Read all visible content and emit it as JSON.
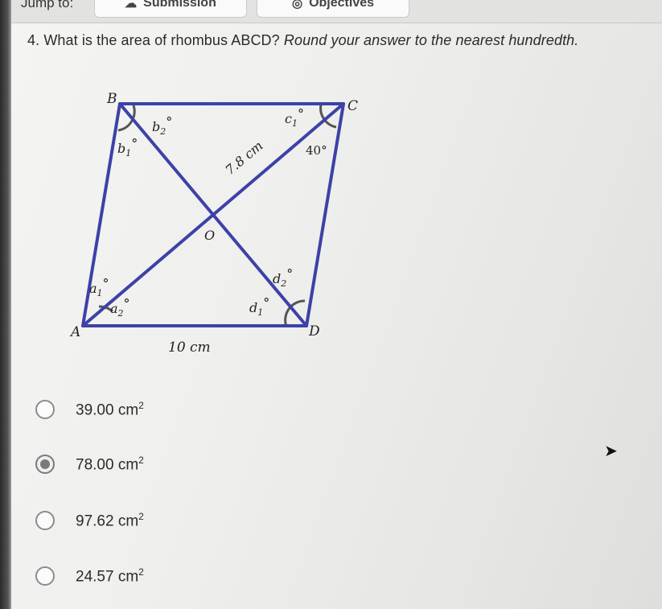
{
  "nav": {
    "jump_label": "Jump to:",
    "buttons": [
      {
        "label": "Submission",
        "icon": "upload-cloud-icon"
      },
      {
        "label": "Objectives",
        "icon": "target-icon"
      }
    ]
  },
  "question": {
    "text_plain": "4. What is the area of rhombus ABCD? ",
    "text_italic": "Round your answer to the nearest hundredth."
  },
  "figure": {
    "vertices": [
      "A",
      "B",
      "C",
      "D"
    ],
    "center_label": "O",
    "diagonal_length": "7.8 cm",
    "side_length": "10 cm",
    "angle_c2": "40°",
    "angle_labels": {
      "a1": "a",
      "a1_sub": "1",
      "a2": "a",
      "a2_sub": "2",
      "b1": "b",
      "b1_sub": "1",
      "b2": "b",
      "b2_sub": "2",
      "c1": "c",
      "c1_sub": "1",
      "d1": "d",
      "d1_sub": "1",
      "d2": "d",
      "d2_sub": "2",
      "degree": "°"
    },
    "line_color": "#3d41a8"
  },
  "choices": [
    {
      "value": "39.00 cm",
      "unit_exp": "2",
      "selected": false
    },
    {
      "value": "78.00 cm",
      "unit_exp": "2",
      "selected": true
    },
    {
      "value": "97.62 cm",
      "unit_exp": "2",
      "selected": false
    },
    {
      "value": "24.57 cm",
      "unit_exp": "2",
      "selected": false
    }
  ]
}
